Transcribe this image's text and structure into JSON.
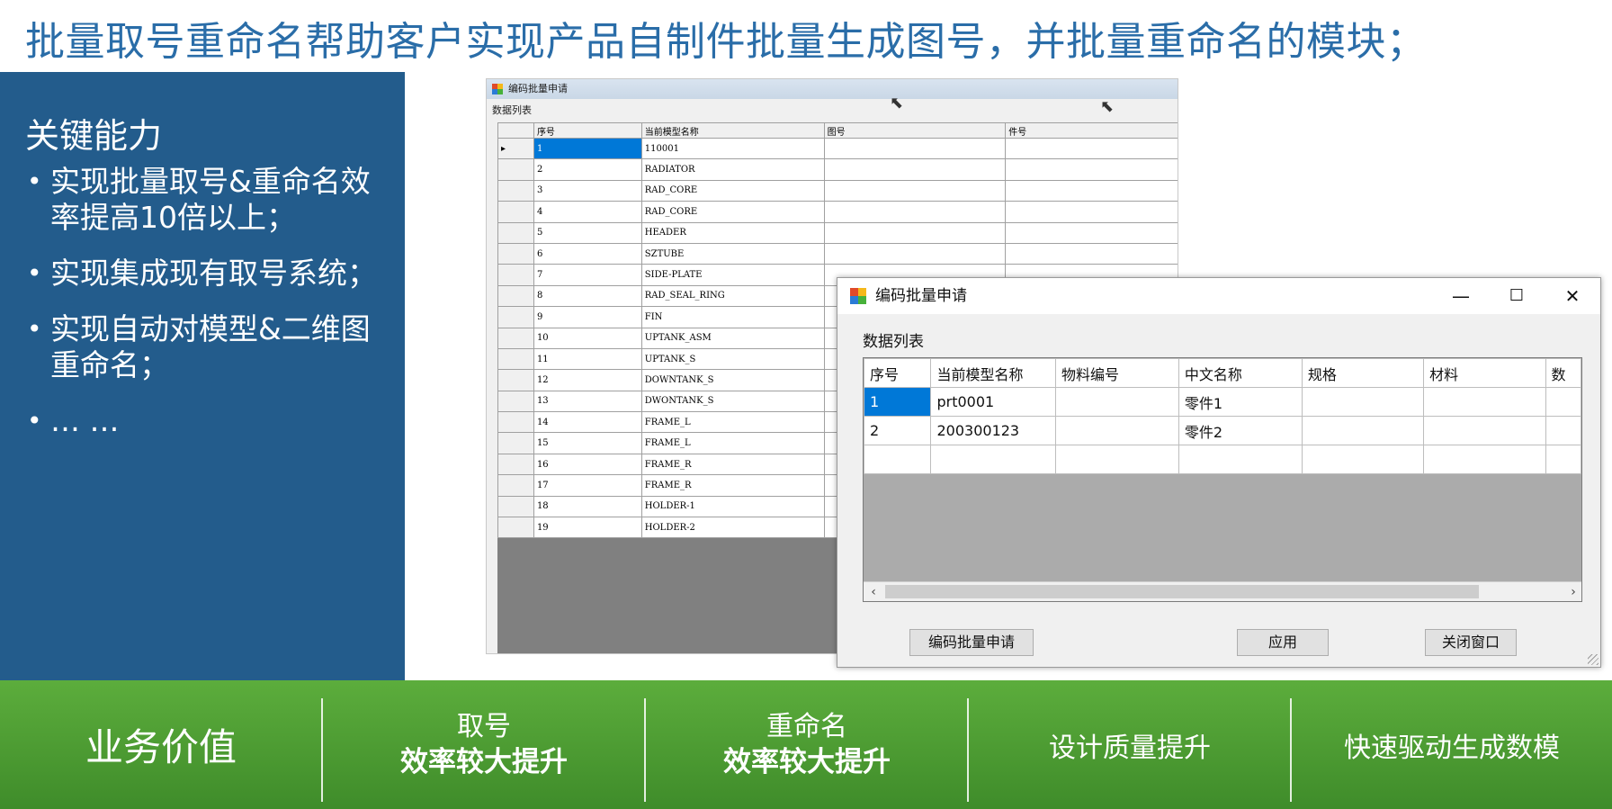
{
  "title": "批量取号重命名帮助客户实现产品自制件批量生成图号，并批量重命名的模块；",
  "left_panel": {
    "heading": "关键能力",
    "bullets": [
      "实现批量取号&重命名效率提高10倍以上；",
      "实现集成现有取号系统；",
      "实现自动对模型&二维图重命名；",
      "… …"
    ],
    "background_color": "#235c8c"
  },
  "back_window": {
    "title": "编码批量申请",
    "group_label": "数据列表",
    "columns": [
      "序号",
      "当前模型名称",
      "图号",
      "件号"
    ],
    "selected_row_marker": "▸",
    "rows": [
      [
        "1",
        "110001"
      ],
      [
        "2",
        "RADIATOR"
      ],
      [
        "3",
        "RAD_CORE"
      ],
      [
        "4",
        "RAD_CORE"
      ],
      [
        "5",
        "HEADER"
      ],
      [
        "6",
        "SZTUBE"
      ],
      [
        "7",
        "SIDE-PLATE"
      ],
      [
        "8",
        "RAD_SEAL_RING"
      ],
      [
        "9",
        "FIN"
      ],
      [
        "10",
        "UPTANK_ASM"
      ],
      [
        "11",
        "UPTANK_S"
      ],
      [
        "12",
        "DOWNTANK_S"
      ],
      [
        "13",
        "DWONTANK_S"
      ],
      [
        "14",
        "FRAME_L"
      ],
      [
        "15",
        "FRAME_L"
      ],
      [
        "16",
        "FRAME_R"
      ],
      [
        "17",
        "FRAME_R"
      ],
      [
        "18",
        "HOLDER-1"
      ],
      [
        "19",
        "HOLDER-2"
      ]
    ]
  },
  "dialog": {
    "title": "编码批量申请",
    "controls": {
      "minimize": "—",
      "maximize": "☐",
      "close": "✕"
    },
    "group_label": "数据列表",
    "columns": [
      "序号",
      "当前模型名称",
      "物料编号",
      "中文名称",
      "规格",
      "材料",
      "数"
    ],
    "rows": [
      [
        "1",
        "prt0001",
        "",
        "零件1",
        "",
        "",
        ""
      ],
      [
        "2",
        "200300123",
        "",
        "零件2",
        "",
        "",
        ""
      ]
    ],
    "scroll_left": "‹",
    "scroll_right": "›",
    "buttons": {
      "apply_batch": "编码批量申请",
      "apply": "应用",
      "close_window": "关闭窗口"
    },
    "selection_color": "#0078d7"
  },
  "bottom_bar": {
    "title": "业务价值",
    "cells": [
      {
        "top": "取号",
        "bottom": "效率较大提升"
      },
      {
        "top": "重命名",
        "bottom": "效率较大提升"
      },
      {
        "text": "设计质量提升"
      },
      {
        "text": "快速驱动生成数模"
      }
    ],
    "colors": {
      "top": "#5cad3c",
      "bottom": "#3f8c2a"
    }
  }
}
